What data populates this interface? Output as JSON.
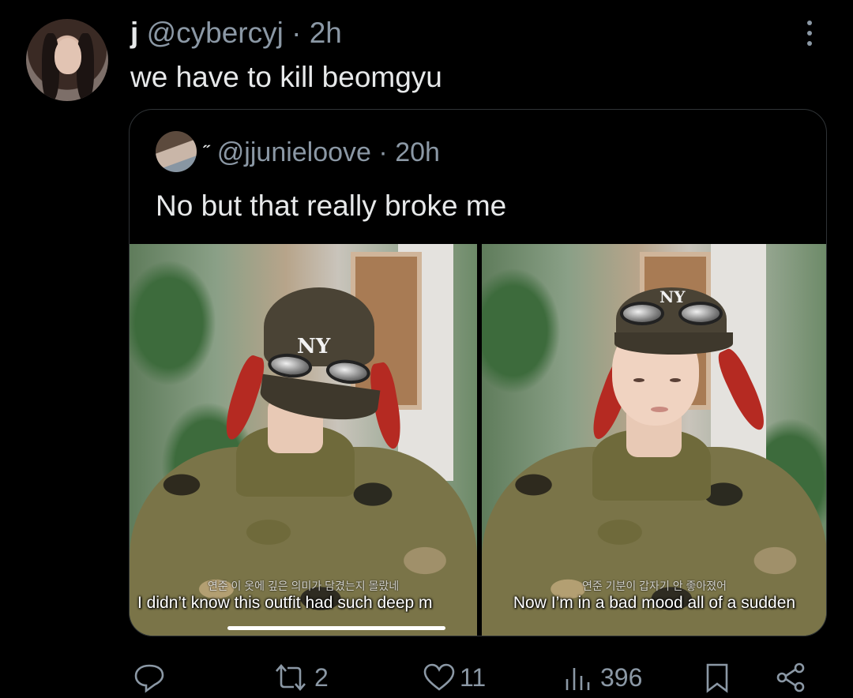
{
  "tweet": {
    "author_name": "j",
    "author_handle": "@cybercyj",
    "separator": "·",
    "time": "2h",
    "text": "we have to kill beomgyu"
  },
  "quote": {
    "author_name": "˝",
    "author_handle": "@jjunieloove",
    "separator": "·",
    "time": "20h",
    "text": "No but that really broke me",
    "media": [
      {
        "subtitle_ko": "연준   이 옷에 깊은 의미가 담겼는지 몰랐네",
        "subtitle_en": "I didn’t know this outfit had such deep m"
      },
      {
        "subtitle_ko": "연준   기분이 갑자기 안 좋아졌어",
        "subtitle_en": "Now I’m in a bad mood all of a sudden"
      }
    ]
  },
  "actions": {
    "reply_count": "",
    "retweet_count": "2",
    "like_count": "11",
    "view_count": "396"
  },
  "icons": [
    "more-icon",
    "reply-icon",
    "retweet-icon",
    "like-icon",
    "views-icon",
    "bookmark-icon",
    "share-icon"
  ],
  "colors": {
    "background": "#000000",
    "text": "#e7e9ea",
    "muted": "#8b98a5",
    "border": "#2f3336"
  }
}
